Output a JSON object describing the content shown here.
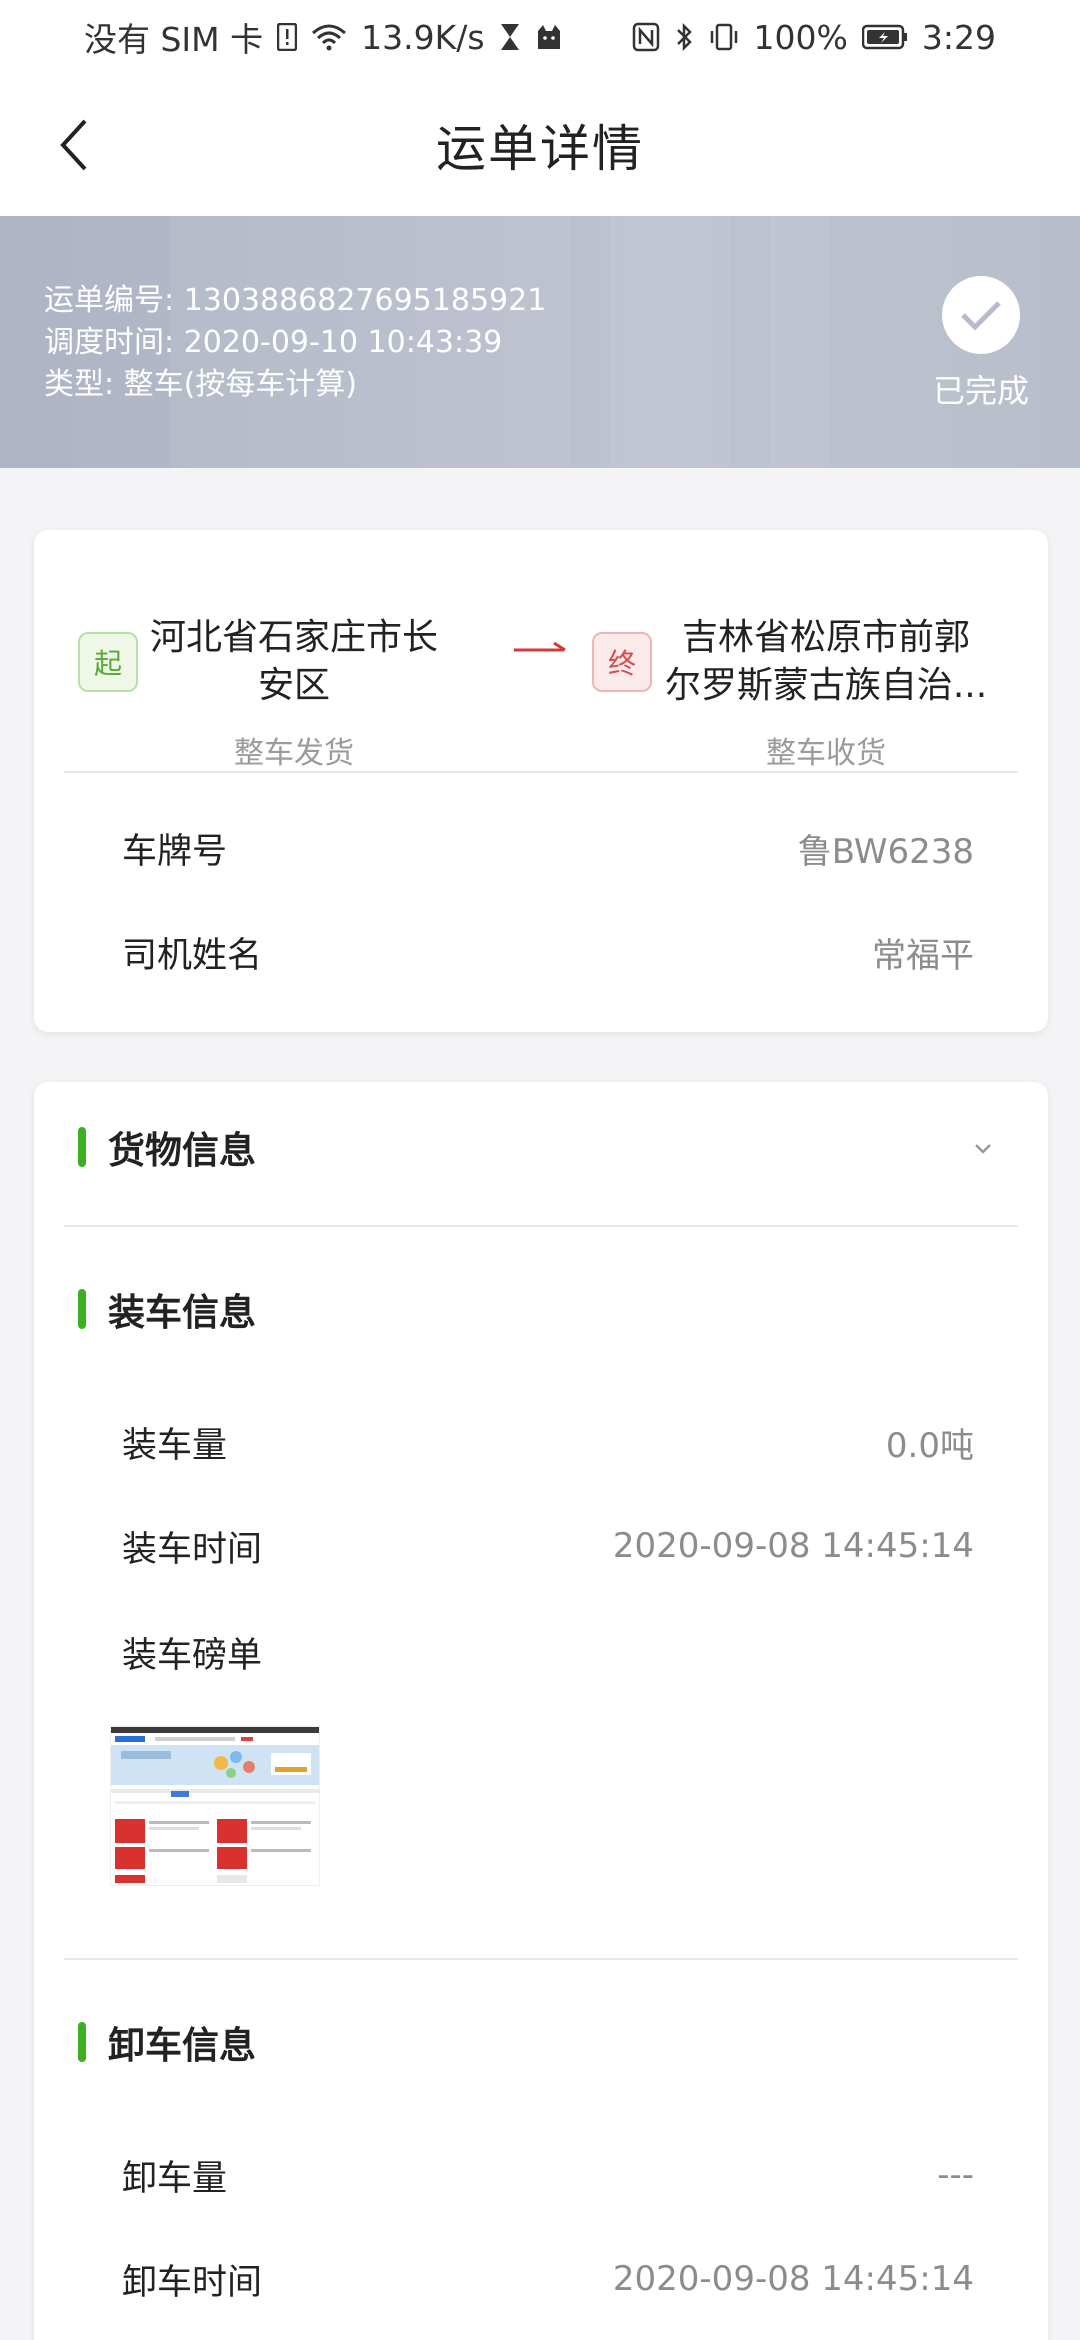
{
  "status_bar": {
    "carrier": "没有 SIM 卡",
    "net_speed": "13.9K/s",
    "battery": "100%",
    "time": "3:29"
  },
  "nav": {
    "title": "运单详情"
  },
  "banner": {
    "waybill_no": "运单编号: 1303886827695185921",
    "dispatch_time": "调度时间: 2020-09-10 10:43:39",
    "type": "类型: 整车(按每车计算)",
    "status": "已完成"
  },
  "route": {
    "start_badge": "起",
    "end_badge": "终",
    "from_place_line1": "河北省石家庄市长",
    "from_place_line2": "安区",
    "from_sub": "整车发货",
    "to_place_line1": "吉林省松原市前郭",
    "to_place_line2": "尔罗斯蒙古族自治...",
    "to_sub": "整车收货"
  },
  "vehicle": {
    "plate_label": "车牌号",
    "plate_value": "鲁BW6238",
    "driver_label": "司机姓名",
    "driver_value": "常福平"
  },
  "cargo_section": {
    "title": "货物信息"
  },
  "loading_section": {
    "title": "装车信息",
    "qty_label": "装车量",
    "qty_value": "0.0吨",
    "time_label": "装车时间",
    "time_value": "2020-09-08 14:45:14",
    "weighbill_label": "装车磅单"
  },
  "unloading_section": {
    "title": "卸车信息",
    "qty_label": "卸车量",
    "qty_value": "---",
    "time_label": "卸车时间",
    "time_value": "2020-09-08 14:45:14"
  },
  "colors": {
    "accent_green": "#3cb021",
    "arrow_red": "#d43a3a",
    "banner_grey": "#b7bccb"
  }
}
